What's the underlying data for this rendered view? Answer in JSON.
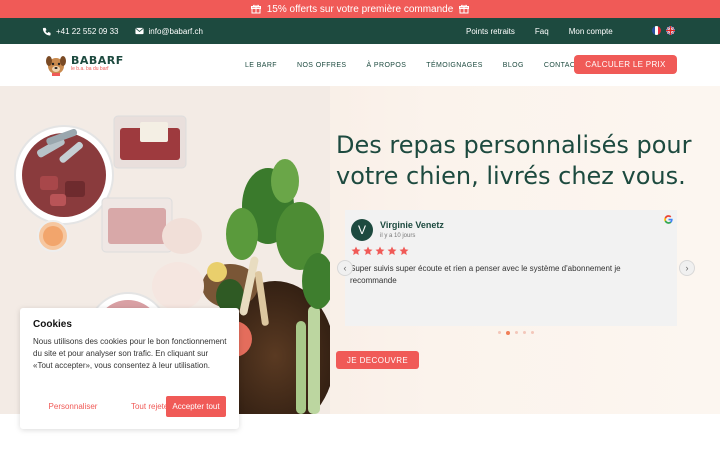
{
  "promo": {
    "text": "15% offerts sur votre première commande"
  },
  "topbar": {
    "phone": "+41 22 552 09 33",
    "email": "info@babarf.ch",
    "links": [
      "Points retraits",
      "Faq",
      "Mon compte"
    ]
  },
  "logo": {
    "brand": "BABARF",
    "tagline": "le b.a. ba du barf"
  },
  "nav": {
    "items": [
      "LE BARF",
      "NOS OFFRES",
      "À PROPOS",
      "TÉMOIGNAGES",
      "BLOG",
      "CONTACT"
    ],
    "cta": "CALCULER LE PRIX"
  },
  "hero": {
    "headline": "Des repas personnalisés pour votre chien, livrés chez vous.",
    "button": "JE DECOUVRE"
  },
  "review": {
    "initial": "V",
    "name": "Virginie Venetz",
    "date": "il y a 10 jours",
    "rating": 5,
    "text": "Super suivis super écoute et rien a penser avec le système d'abonnement je recommande",
    "slide_index": 2,
    "slide_count": 5
  },
  "cookie": {
    "title": "Cookies",
    "body": "Nous utilisons des cookies pour le bon fonctionnement du site et pour analyser son trafic. En cliquant sur «Tout accepter», vous consentez à leur utilisation.",
    "customize": "Personnaliser",
    "reject": "Tout rejeter",
    "accept": "Accepter tout"
  },
  "colors": {
    "brand_red": "#f05a57",
    "brand_green": "#1d4a3f",
    "star": "#f05a57"
  }
}
